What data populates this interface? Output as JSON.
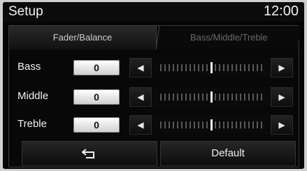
{
  "title_bar": {
    "title": "Setup",
    "clock": "12:00"
  },
  "tabs": [
    {
      "label": "Fader/Balance",
      "selected": false
    },
    {
      "label": "Bass/Middle/Treble",
      "selected": true
    }
  ],
  "controls": [
    {
      "label": "Bass",
      "value": "0",
      "level": 0.5,
      "decrease_icon": "triangle-left-icon",
      "increase_icon": "triangle-right-icon"
    },
    {
      "label": "Middle",
      "value": "0",
      "level": 0.5,
      "decrease_icon": "triangle-left-icon",
      "increase_icon": "triangle-right-icon"
    },
    {
      "label": "Treble",
      "value": "0",
      "level": 0.5,
      "decrease_icon": "triangle-left-icon",
      "increase_icon": "triangle-right-icon"
    }
  ],
  "buttons": {
    "back_icon": "return-arrow-icon",
    "default_label": "Default"
  },
  "colors": {
    "background": "#050505",
    "text": "#f0f0f0",
    "value_box": "#ffffff",
    "inactive_tab_text": "#6a6a6a"
  }
}
